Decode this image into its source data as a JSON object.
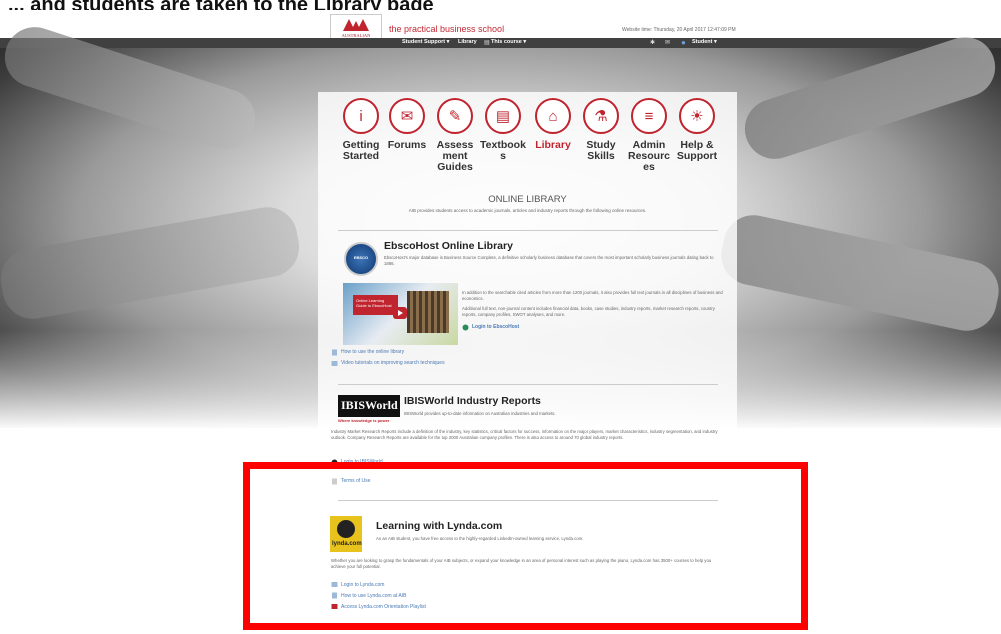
{
  "caption": "... and students are taken to the Library page",
  "header": {
    "logo_text": "AUSTRALIAN INSTITUTE of BUSINESS",
    "tagline": "the practical business school",
    "login_info": "Website time: Thursday, 20 April 2017 12:47:09 PM"
  },
  "nav": {
    "items": [
      "Student Support ▾",
      "Library",
      "This course ▾",
      "Student ▾"
    ]
  },
  "categories": [
    {
      "label": "Getting Started",
      "icon": "info-icon",
      "glyph": "i"
    },
    {
      "label": "Forums",
      "icon": "chat-icon",
      "glyph": "✉"
    },
    {
      "label": "Assessment Guides",
      "icon": "document-icon",
      "glyph": "✎"
    },
    {
      "label": "Textbooks",
      "icon": "book-icon",
      "glyph": "▤"
    },
    {
      "label": "Library",
      "icon": "library-icon",
      "glyph": "⌂"
    },
    {
      "label": "Study Skills",
      "icon": "flask-icon",
      "glyph": "⚗"
    },
    {
      "label": "Admin Resources",
      "icon": "list-icon",
      "glyph": "≡"
    },
    {
      "label": "Help & Support",
      "icon": "lightbulb-icon",
      "glyph": "☀"
    }
  ],
  "library": {
    "title": "ONLINE LIBRARY",
    "subtitle": "AIB provides students access to academic journals, articles and industry reports through the following online resources."
  },
  "ebsco": {
    "logo": "EBSCO",
    "title": "EbscoHost Online Library",
    "desc": "EbscoHost's major database is Business Source Complete, a definitive scholarly business database that covers the most important scholarly business journals dating back to 1886.",
    "video_label": "Online Learning Guide to EbscoHost",
    "p1": "In addition to the searchable cited articles from more than 1200 journals, it also provides full text journals in all disciplines of business and economics.",
    "p2": "Additional full text, non-journal content includes financial data, books, case studies, industry reports, market research reports, country reports, company profiles, SWOT analyses, and more.",
    "login": "Login to EbscoHost",
    "links": [
      "How to use the online library",
      "Video tutorials on improving search techniques"
    ]
  },
  "ibis": {
    "logo": "IBISWorld",
    "tag": "Where knowledge is power",
    "title": "IBISWorld Industry Reports",
    "desc": "IBISWorld provides up-to-date information on Australian industries and markets.",
    "body": "Industry Market Research Reports include a definition of the industry, key statistics, critical factors for success, information on the major players, market characteristics, industry segmentation, and industry outlook. Company Research Reports are available for the top 2000 Australian company profiles. There is also access to around 70 global industry reports.",
    "login": "Login to IBISWorld",
    "terms": "Terms of Use"
  },
  "lynda": {
    "logo": "lynda.com",
    "title": "Learning with Lynda.com",
    "desc": "As an AIB student, you have free access to the highly-regarded LinkedIn-owned learning service, Lynda.com.",
    "body": "Whether you are looking to grasp the fundamentals of your AIB subjects, or expand your knowledge in an area of personal interest such as playing the piano, Lynda.com has 3500+ courses to help you achieve your full potential.",
    "links": [
      "Login to Lynda.com",
      "How to use Lynda.com at AIB",
      "Access Lynda.com Orientation Playlist"
    ]
  },
  "colors": {
    "accent": "#c0242f",
    "highlight": "#ff0000",
    "link": "#4a7ab5",
    "nav": "#404040"
  }
}
